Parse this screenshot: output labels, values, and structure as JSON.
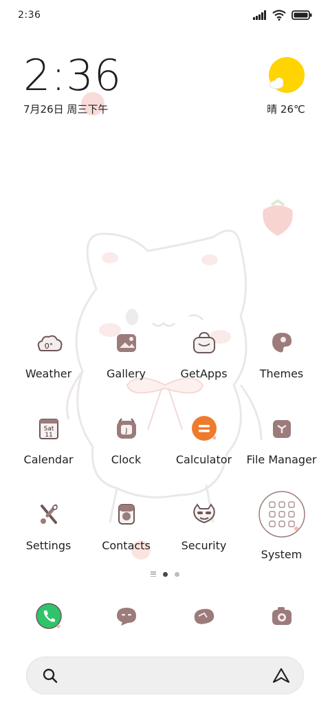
{
  "status_bar": {
    "time": "2:36",
    "icons": [
      "signal-icon",
      "wifi-icon",
      "battery-icon"
    ]
  },
  "clock_widget": {
    "time": "2:36",
    "date": "7月26日 周三下午"
  },
  "weather_widget": {
    "condition_icon": "sun-cloud-icon",
    "text": "晴 26℃"
  },
  "apps": [
    [
      {
        "label": "Weather",
        "icon": "weather-icon"
      },
      {
        "label": "Gallery",
        "icon": "gallery-icon"
      },
      {
        "label": "GetApps",
        "icon": "getapps-icon"
      },
      {
        "label": "Themes",
        "icon": "themes-icon"
      }
    ],
    [
      {
        "label": "Calendar",
        "icon": "calendar-icon",
        "icon_text_day": "Sat",
        "icon_text_date": "11"
      },
      {
        "label": "Clock",
        "icon": "clock-icon",
        "icon_text": "J"
      },
      {
        "label": "Calculator",
        "icon": "calculator-icon"
      },
      {
        "label": "File Manager",
        "icon": "file-manager-icon"
      }
    ],
    [
      {
        "label": "Settings",
        "icon": "settings-icon"
      },
      {
        "label": "Contacts",
        "icon": "contacts-icon"
      },
      {
        "label": "Security",
        "icon": "security-icon"
      },
      {
        "label": "System",
        "icon": "system-folder-icon"
      }
    ]
  ],
  "weather_icon_text": "0°",
  "page_indicator": {
    "pages": 2,
    "active": 1
  },
  "dock": [
    {
      "icon": "phone-icon"
    },
    {
      "icon": "messages-icon"
    },
    {
      "icon": "browser-icon"
    },
    {
      "icon": "camera-icon"
    }
  ],
  "search_bar": {
    "left_icon": "search-icon",
    "right_icon": "assistant-icon"
  },
  "colors": {
    "icon_brown": "#9c7b7b",
    "icon_outline": "#6d5556",
    "phone_green": "#2fc46a",
    "calculator_orange": "#f07a2c",
    "sun_yellow": "#ffd400"
  }
}
